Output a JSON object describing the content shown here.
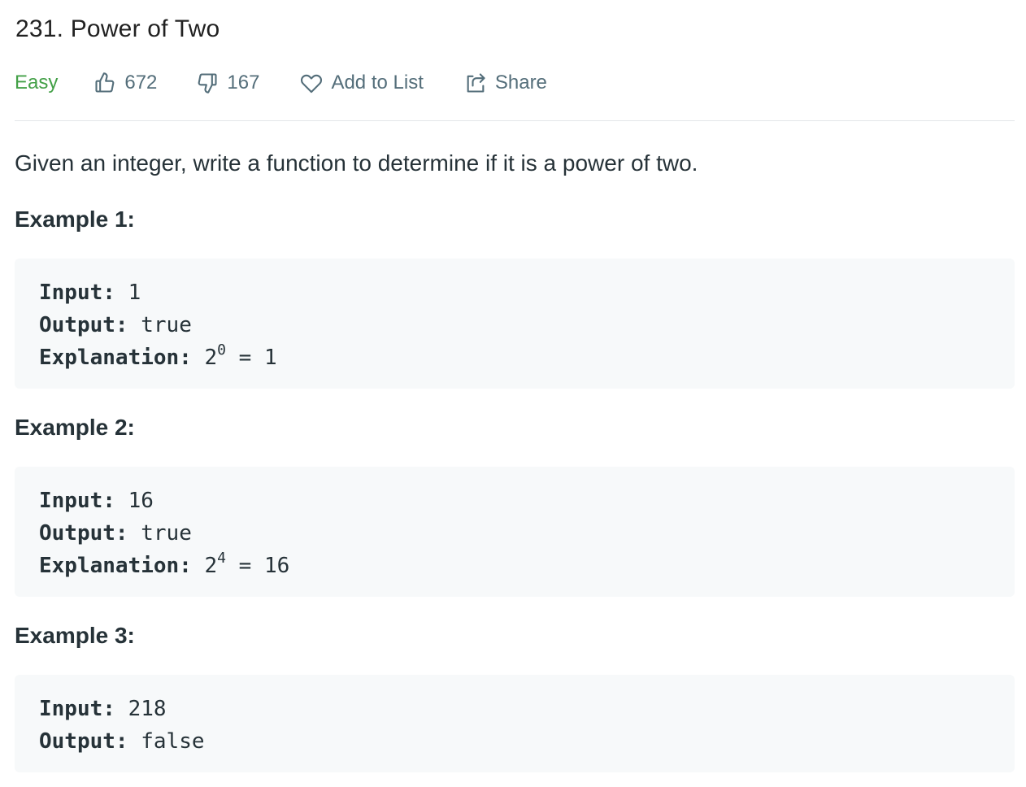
{
  "problem": {
    "title": "231. Power of Two",
    "difficulty": "Easy",
    "likes": "672",
    "dislikes": "167",
    "add_to_list_label": "Add to List",
    "share_label": "Share",
    "description": "Given an integer, write a function to determine if it is a power of two."
  },
  "icons": {
    "like": "thumbs-up-icon",
    "dislike": "thumbs-down-icon",
    "favorite": "heart-icon",
    "share": "share-icon"
  },
  "colors": {
    "difficulty_easy": "#43a047",
    "meta_text": "#546e7a",
    "code_background": "#f7f9fa",
    "text": "#263238"
  },
  "examples": [
    {
      "heading": "Example 1:",
      "input_label": "Input:",
      "input_value": "1",
      "output_label": "Output:",
      "output_value": "true",
      "explanation_label": "Explanation:",
      "explanation_base": "2",
      "explanation_exponent": "0",
      "explanation_rest": "= 1"
    },
    {
      "heading": "Example 2:",
      "input_label": "Input:",
      "input_value": "16",
      "output_label": "Output:",
      "output_value": "true",
      "explanation_label": "Explanation:",
      "explanation_base": "2",
      "explanation_exponent": "4",
      "explanation_rest": "= 16"
    },
    {
      "heading": "Example 3:",
      "input_label": "Input:",
      "input_value": "218",
      "output_label": "Output:",
      "output_value": "false"
    }
  ]
}
